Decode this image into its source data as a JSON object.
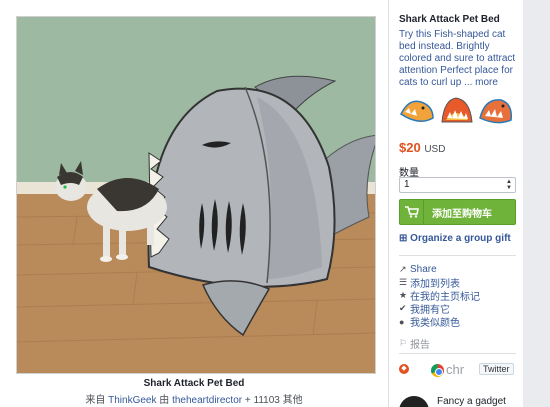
{
  "photo": {
    "caption_title": "Shark Attack Pet Bed",
    "attribution_prefix": "来自",
    "attribution_source": "ThinkGeek",
    "attribution_joiner": "由",
    "attribution_user": "theheartdirector",
    "attribution_suffix": "+ 11103 其他"
  },
  "product": {
    "title": "Shark Attack Pet Bed",
    "description": "Try this Fish-shaped cat bed instead. Brightly colored and sure to attract attention Perfect place for cats to curl up ...",
    "more_label": "more",
    "price": "$20",
    "currency": "USD",
    "quantity_label": "数量",
    "quantity_value": "1",
    "add_to_cart_label": "添加至购物车",
    "group_gift_label": "Organize a group gift",
    "thumbnail_colors": [
      "#f2a23a",
      "#e85a2a",
      "#e8703a"
    ]
  },
  "actions": [
    {
      "icon": "↗",
      "label": "Share"
    },
    {
      "icon": "☰",
      "label": "添加到列表"
    },
    {
      "icon": "★",
      "label": "在我的主页标记"
    },
    {
      "icon": "✔",
      "label": "我拥有它"
    },
    {
      "icon": "●",
      "label": "我类似颜色"
    }
  ],
  "report_label": "报告",
  "share_bar": {
    "chrome_text": "chr",
    "twitter_label": "Twitter"
  },
  "promo": {
    "text": "Fancy a gadget"
  },
  "colors": {
    "accent_green": "#6fb33a",
    "link_blue": "#365899",
    "price_orange": "#e0521f"
  }
}
